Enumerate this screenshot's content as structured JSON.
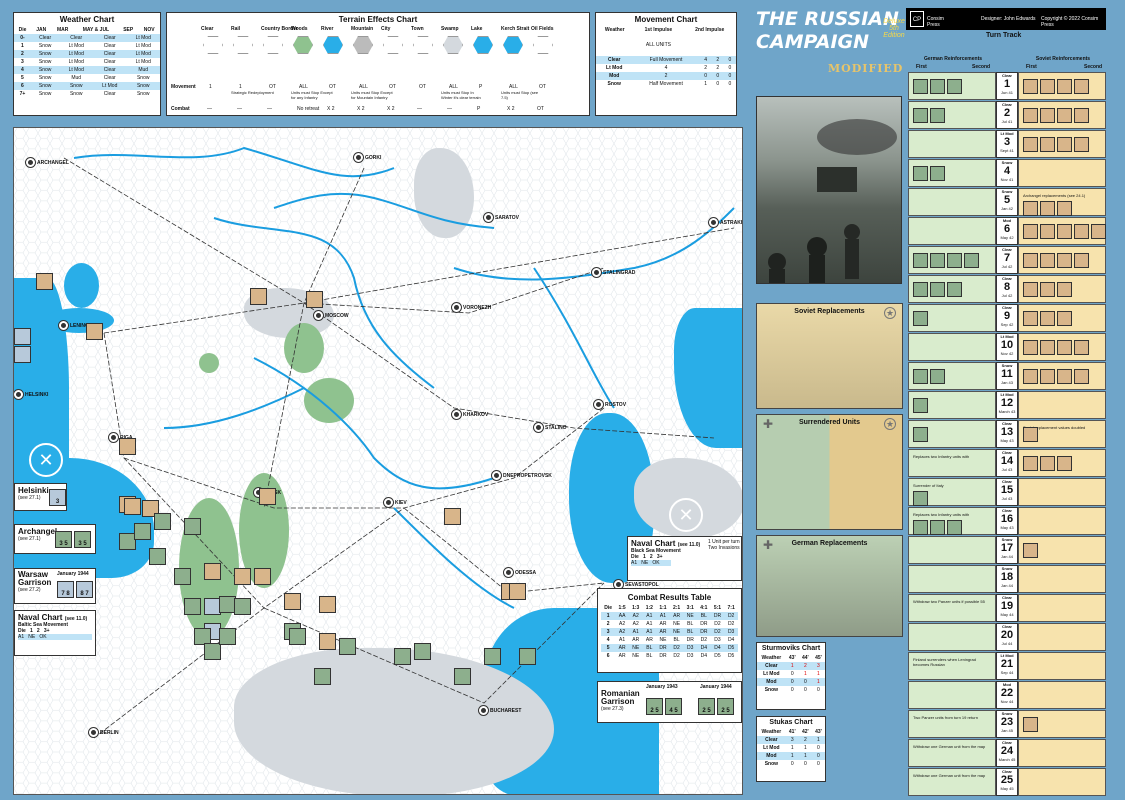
{
  "weather_chart": {
    "title": "Weather Chart",
    "headers": [
      "Die",
      "JAN",
      "MAR",
      "MAY & JUL",
      "SEP",
      "NOV"
    ],
    "rows": [
      [
        "0-",
        "Clear",
        "Clear",
        "Clear",
        "Lt Mod"
      ],
      [
        "1",
        "Snow",
        "Lt Mod",
        "Clear",
        "Lt Mod"
      ],
      [
        "2",
        "Snow",
        "Lt Mod",
        "Clear",
        "Lt Mod"
      ],
      [
        "3",
        "Snow",
        "Lt Mod",
        "Clear",
        "Lt Mod"
      ],
      [
        "4",
        "Snow",
        "Lt Mod",
        "Clear",
        "Mud"
      ],
      [
        "5",
        "Snow",
        "Mud",
        "Clear",
        "Snow"
      ],
      [
        "6",
        "Snow",
        "Snow",
        "Lt Mod",
        "Snow"
      ],
      [
        "7+",
        "Snow",
        "Snow",
        "Clear",
        "Snow"
      ]
    ]
  },
  "terrain_chart": {
    "title": "Terrain Effects Chart",
    "terrain": [
      "Clear",
      "Rail",
      "Country Border",
      "Woods",
      "River",
      "Mountain",
      "City",
      "Town",
      "Swamp",
      "Lake",
      "Kerch Strait",
      "Oil Fields"
    ],
    "movement_label": "Movement",
    "combat_label": "Combat",
    "movement": [
      "1",
      "1",
      "OT",
      "ALL",
      "OT",
      "ALL",
      "OT",
      "OT",
      "ALL",
      "P",
      "ALL",
      "OT"
    ],
    "combat": [
      "—",
      "—",
      "—",
      "No retreat",
      "X 2",
      "X 2",
      "X 2",
      "—",
      "—",
      "P",
      "X 2",
      "OT"
    ],
    "notes": {
      "rail": "Strategic Redeployment",
      "woods": "Units must Stop Except for any Infantry",
      "mountain": "Units must Stop Except for Mountain Infantry",
      "swamp": "Units must Stop In Winter it's clear terrain",
      "kerch": "Units must Stop (see 7.5)"
    }
  },
  "movement_chart": {
    "title": "Movement Chart",
    "headers": [
      "Weather",
      "1st Impulse",
      "2nd Impulse"
    ],
    "sub": [
      "ALL UNITS"
    ],
    "rows": [
      [
        "Clear",
        "Full Movement",
        "4",
        "2",
        "0"
      ],
      [
        "Lt Mod",
        "4",
        "2",
        "2",
        "0"
      ],
      [
        "Mod",
        "2",
        "0",
        "0",
        "0"
      ],
      [
        "Snow",
        "Half Movement",
        "1",
        "0",
        "0"
      ]
    ]
  },
  "game_title": {
    "line1": "THE RUSSIAN",
    "line2": "CAMPAIGN",
    "modified": "MODIFIED",
    "deluxe": "Deluxe 5th Edition"
  },
  "credits": {
    "publisher": "Consim Press",
    "designer": "Designer: John Edwards",
    "copyright": "Copyright © 2022 Consim Press"
  },
  "turn_track": {
    "title": "Turn Track",
    "german_header": "German Reinforcements",
    "soviet_header": "Soviet Reinforcements",
    "first": "First",
    "second": "Second",
    "turns": [
      {
        "w": "Clear",
        "n": "1",
        "d": "Jun 41"
      },
      {
        "w": "Clear",
        "n": "2",
        "d": "Jul 41"
      },
      {
        "w": "Lt Mod",
        "n": "3",
        "d": "Sept 41"
      },
      {
        "w": "Snow",
        "n": "4",
        "d": "Nov 41"
      },
      {
        "w": "Snow",
        "n": "5",
        "d": "Jan 42"
      },
      {
        "w": "Mod",
        "n": "6",
        "d": "May 42"
      },
      {
        "w": "Clear",
        "n": "7",
        "d": "Jul 42"
      },
      {
        "w": "Clear",
        "n": "8",
        "d": "Jul 42"
      },
      {
        "w": "Clear",
        "n": "9",
        "d": "Sep 42"
      },
      {
        "w": "Lt Mod",
        "n": "10",
        "d": "Nov 42"
      },
      {
        "w": "Snow",
        "n": "11",
        "d": "Jan 43"
      },
      {
        "w": "Lt Mod",
        "n": "12",
        "d": "March 43"
      },
      {
        "w": "Clear",
        "n": "13",
        "d": "May 43"
      },
      {
        "w": "Clear",
        "n": "14",
        "d": "Jul 43"
      },
      {
        "w": "Clear",
        "n": "15",
        "d": "Jul 43"
      },
      {
        "w": "Clear",
        "n": "16",
        "d": "May 43"
      },
      {
        "w": "Snow",
        "n": "17",
        "d": "Jan 44"
      },
      {
        "w": "Snow",
        "n": "18",
        "d": "Jan 44"
      },
      {
        "w": "Clear",
        "n": "19",
        "d": "May 44"
      },
      {
        "w": "Clear",
        "n": "20",
        "d": "Jul 44"
      },
      {
        "w": "Lt Mod",
        "n": "21",
        "d": "Sep 44"
      },
      {
        "w": "Mod",
        "n": "22",
        "d": "Nov 44"
      },
      {
        "w": "Snow",
        "n": "23",
        "d": "Jan 45"
      },
      {
        "w": "Clear",
        "n": "24",
        "d": "March 45"
      },
      {
        "w": "Clear",
        "n": "25",
        "d": "May 45"
      }
    ],
    "notes": {
      "5r": "Archangel replacements (see 24.1)",
      "13r": "Soviet replacement values doubled",
      "14l": "Replaces two Infantry units with",
      "15l": "Surrender of Italy",
      "16l": "Replaces two Infantry units with",
      "19l": "Withdraw two Panzer units if possible 55",
      "21l": "Finland surrenders when Leningrad becomes Russian",
      "23l": "Two Panzer units from turn 19 return",
      "24l": "Withdraw one German unit from the map",
      "25l": "Withdraw one German unit from the map"
    }
  },
  "side_boxes": {
    "soviet_replacements": "Soviet Replacements",
    "surrendered_units": "Surrendered Units",
    "german_replacements": "German Replacements"
  },
  "sturmoviks": {
    "title": "Sturmoviks Chart",
    "headers": [
      "Weather",
      "43'",
      "44'",
      "45'"
    ],
    "rows": [
      [
        "Clear",
        "1",
        "2",
        "3"
      ],
      [
        "Lt Mod",
        "0",
        "1",
        "1"
      ],
      [
        "Mod",
        "0",
        "0",
        "1"
      ],
      [
        "Snow",
        "0",
        "0",
        "0"
      ]
    ]
  },
  "stukas": {
    "title": "Stukas Chart",
    "headers": [
      "Weather",
      "41'",
      "42'",
      "43'"
    ],
    "rows": [
      [
        "Clear",
        "3",
        "2",
        "1"
      ],
      [
        "Lt Mod",
        "1",
        "1",
        "0"
      ],
      [
        "Mod",
        "1",
        "1",
        "0"
      ],
      [
        "Snow",
        "0",
        "0",
        "0"
      ]
    ]
  },
  "crt": {
    "title": "Combat Results Table",
    "headers": [
      "Die",
      "1:5",
      "1:3",
      "1:2",
      "1:1",
      "2:1",
      "3:1",
      "4:1",
      "5:1",
      "7:1"
    ],
    "rows": [
      [
        "1",
        "AA",
        "A2",
        "A1",
        "A1",
        "AR",
        "NE",
        "BL",
        "DR",
        "D2"
      ],
      [
        "2",
        "A2",
        "A2",
        "A1",
        "AR",
        "NE",
        "BL",
        "DR",
        "D2",
        "D2"
      ],
      [
        "3",
        "A2",
        "A1",
        "A1",
        "AR",
        "NE",
        "BL",
        "DR",
        "D2",
        "D3"
      ],
      [
        "4",
        "A1",
        "AR",
        "AR",
        "NE",
        "BL",
        "DR",
        "D2",
        "D3",
        "D4"
      ],
      [
        "5",
        "AR",
        "NE",
        "BL",
        "DR",
        "D2",
        "D3",
        "D4",
        "D4",
        "D5"
      ],
      [
        "6",
        "AR",
        "NE",
        "BL",
        "DR",
        "D2",
        "D3",
        "D4",
        "D5",
        "D5"
      ]
    ]
  },
  "naval_black_sea": {
    "title": "Naval Chart",
    "see": "(see 11.0)",
    "sub": "Black Sea Movement",
    "note": "1 Unit per turn Two Invasions",
    "die": [
      "Die",
      "1",
      "2",
      "3+"
    ],
    "res": [
      "A1",
      "NE",
      "OK"
    ]
  },
  "naval_baltic": {
    "title": "Naval Chart",
    "see": "(see 11.0)",
    "sub": "Baltic Sea Movement",
    "die": [
      "Die",
      "1",
      "2",
      "3+"
    ],
    "res": [
      "A1",
      "NE",
      "OK"
    ]
  },
  "insets": {
    "helsinki": {
      "title": "Helsinki",
      "see": "(see 27.1)"
    },
    "archangel": {
      "title": "Archangel",
      "see": "(see 27.1)"
    },
    "warsaw": {
      "title": "Warsaw Garrison",
      "date": "January 1944",
      "see": "(see 27.2)"
    },
    "romanian": {
      "title": "Romanian Garrison",
      "date1": "January 1943",
      "date2": "January 1944",
      "see": "(see 27.3)"
    }
  },
  "cities": [
    "ARCHANGEL",
    "GORKI",
    "SARATOV",
    "ASTRAKHAN",
    "STALINGRAD",
    "LENINGRAD",
    "MOSCOW",
    "VORONEZH",
    "HELSINKI",
    "KHARKOV",
    "STALINO",
    "ROSTOV",
    "RIGA",
    "MINSK",
    "KIEV",
    "DNEPROPETROVSK",
    "ODESSA",
    "SEVASTOPOL",
    "BUCHAREST",
    "BERLIN"
  ]
}
